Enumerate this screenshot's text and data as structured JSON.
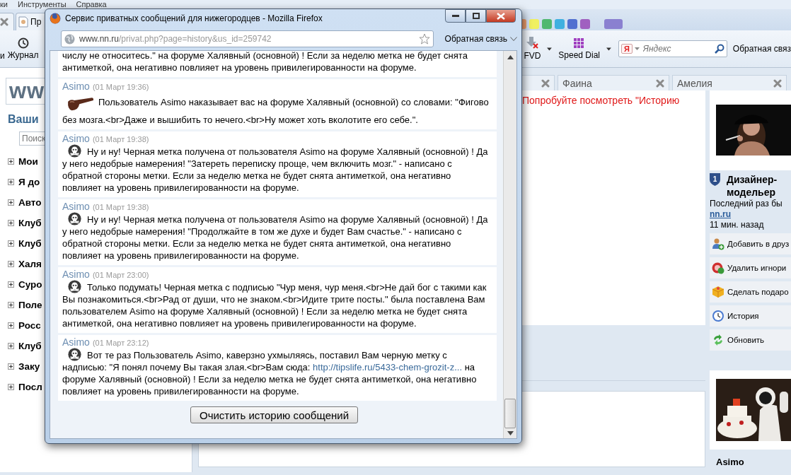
{
  "menu": [
    "ки",
    "Инструменты",
    "Справка"
  ],
  "tab_label": "Пр",
  "toolbar": {
    "left_cut": "и",
    "history": "Журнал",
    "fvd": "FVD",
    "speed_dial": "Speed Dial",
    "search_mark": "Я",
    "search_placeholder": "Яндекс",
    "feedback": "Обратная связ"
  },
  "sidebar": {
    "logo": "ww",
    "heading": "Ваши",
    "search_placeholder": "Поиск",
    "items": [
      "Мои",
      "Я до",
      "Авто",
      "Клуб",
      "Клуб",
      "Халя",
      "Суро",
      "Поле",
      "Росс",
      "Клуб",
      "Заку",
      "Посл"
    ]
  },
  "page_tabs": [
    "Фаина",
    "Амелия"
  ],
  "notice": "Попробуйте посмотреть \"Историю",
  "profile": {
    "rank": "1",
    "title": "Дизайнер-модельер",
    "last_seen": "Последний раз бы",
    "site": "nn.ru",
    "ago": "11 мин. назад",
    "actions": [
      {
        "kind": "add-friend",
        "label": "Добавить в друз"
      },
      {
        "kind": "unignore",
        "label": "Удалить игнори"
      },
      {
        "kind": "gift",
        "label": "Сделать подаро"
      },
      {
        "kind": "history",
        "label": "История"
      },
      {
        "kind": "refresh",
        "label": "Обновить"
      }
    ]
  },
  "author_card": {
    "name": "Asimo"
  },
  "popup": {
    "title": "Сервис приватных сообщений для нижегородцев - Mozilla Firefox",
    "url_host": "www.nn.ru",
    "url_path": "/privat.php?page=history&us_id=259742",
    "feedback": "Обратная связь",
    "partial_text": "числу не относитесь.\" на форуме Халявный (основной) ! Если за неделю метка не будет снята антиметкой, она негативно повлияет на уровень привилегированности на форуме.",
    "messages": [
      {
        "author": "Asimo",
        "date": "(01 Март 19:36)",
        "kind": "pipe",
        "text": "Пользователь Asimo наказывает вас на форуме Халявный (основной) со словами: \"Фигово без мозга.<br>Даже и вышибить то нечего.<br>Ну может хоть вколотите его себе.\"."
      },
      {
        "author": "Asimo",
        "date": "(01 Март 19:38)",
        "kind": "skull",
        "text": "Ну и ну! Черная метка получена от пользователя Asimo на форуме Халявный (основной) ! Да у него недобрые намерения! \"Затереть переписку проще, чем включить мозг.\" - написано с обратной стороны метки. Если за неделю метка не будет снята антиметкой, она негативно повлияет на уровень привилегированности на форуме."
      },
      {
        "author": "Asimo",
        "date": "(01 Март 19:38)",
        "kind": "skull",
        "text": "Ну и ну! Черная метка получена от пользователя Asimo на форуме Халявный (основной) ! Да у него недобрые намерения! \"Продолжайте в том же духе и будет Вам счастье.\" - написано с обратной стороны метки. Если за неделю метка не будет снята антиметкой, она негативно повлияет на уровень привилегированности на форуме."
      },
      {
        "author": "Asimo",
        "date": "(01 Март 23:00)",
        "kind": "skull",
        "text": "Только подумать! Черная метка с подписью \"Чур меня, чур меня.<br>Не дай бог с такими как Вы познакомиться.<br>Рад от души, что не знаком.<br>Идите трите посты.\" была поставлена Вам пользователем Asimo на форуме Халявный (основной) ! Если за неделю метка не будет снята антиметкой, она негативно повлияет на уровень привилегированности на форуме."
      },
      {
        "author": "Asimo",
        "date": "(01 Март 23:12)",
        "kind": "skull",
        "text": "Вот те раз Пользователь Asimo, каверзно ухмыляясь, поставил Вам черную метку с надписью: \"Я понял почему Вы такая злая.<br>Вам сюда:",
        "link": "http://tipslife.ru/5433-chem-grozit-z...",
        "text_after": "на форуме Халявный (основной) ! Если за неделю метка не будет снята антиметкой, она негативно повлияет на уровень привилегированности на форуме."
      }
    ],
    "clear_button": "Очистить историю сообщений"
  }
}
